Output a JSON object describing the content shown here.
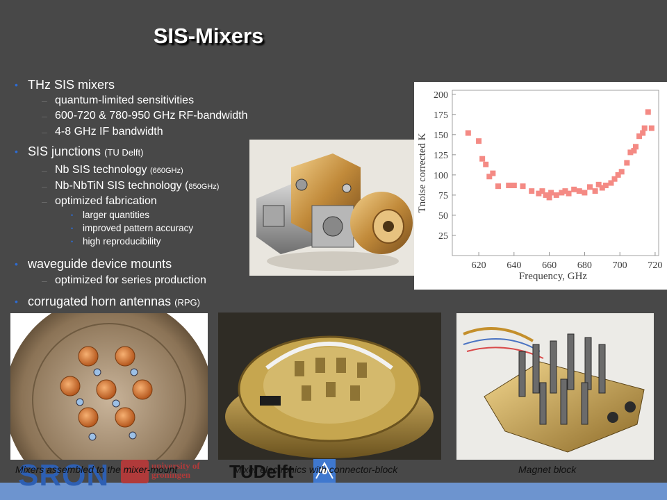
{
  "slide": {
    "title": "SIS-Mixers",
    "bullets": {
      "b1": "THz SIS mixers",
      "b1_1": "quantum-limited sensitivities",
      "b1_2": "600-720 & 780-950 GHz RF-bandwidth",
      "b1_3": "4-8 GHz IF bandwidth",
      "b2": "SIS junctions",
      "b2_note": "(TU Delft)",
      "b2_1": "Nb SIS technology",
      "b2_1_note": "(660GHz)",
      "b2_2": "Nb-NbTiN SIS technology (",
      "b2_2_note": "850GHz)",
      "b2_3": "optimized fabrication",
      "b2_3_1": "larger quantities",
      "b2_3_2": "improved pattern accuracy",
      "b2_3_3": "high reproducibility",
      "b3": "waveguide device mounts",
      "b3_1": "optimized for series production",
      "b4": "corrugated horn antennas",
      "b4_note": "(RPG)"
    },
    "captions": {
      "c1": "Mixers assembled to the mixer-mount",
      "c2": "Mixer electronics with connector-block",
      "c3": "Magnet block"
    },
    "logos": {
      "sron": "SRON",
      "tudelft": "TUDelft",
      "groningen_line1": "university of",
      "groningen_line2": "groningen"
    }
  },
  "chart_data": {
    "type": "scatter",
    "xlabel": "Frequency, GHz",
    "ylabel": "Tnoise corrected K",
    "xlim": [
      605,
      722
    ],
    "ylim": [
      0,
      205
    ],
    "xticks": [
      620,
      640,
      660,
      680,
      700,
      720
    ],
    "yticks": [
      25,
      50,
      75,
      100,
      125,
      150,
      175,
      200
    ],
    "marker_color": "#f48a84",
    "points": [
      [
        614,
        152
      ],
      [
        620,
        142
      ],
      [
        622,
        120
      ],
      [
        624,
        113
      ],
      [
        626,
        98
      ],
      [
        628,
        102
      ],
      [
        631,
        86
      ],
      [
        637,
        87
      ],
      [
        640,
        87
      ],
      [
        645,
        86
      ],
      [
        650,
        80
      ],
      [
        654,
        77
      ],
      [
        656,
        80
      ],
      [
        658,
        75
      ],
      [
        660,
        72
      ],
      [
        661,
        78
      ],
      [
        664,
        75
      ],
      [
        667,
        78
      ],
      [
        669,
        80
      ],
      [
        671,
        77
      ],
      [
        674,
        82
      ],
      [
        677,
        80
      ],
      [
        680,
        78
      ],
      [
        683,
        85
      ],
      [
        686,
        80
      ],
      [
        688,
        88
      ],
      [
        690,
        84
      ],
      [
        692,
        87
      ],
      [
        695,
        90
      ],
      [
        697,
        95
      ],
      [
        699,
        100
      ],
      [
        701,
        104
      ],
      [
        704,
        115
      ],
      [
        706,
        128
      ],
      [
        708,
        130
      ],
      [
        709,
        135
      ],
      [
        711,
        148
      ],
      [
        713,
        152
      ],
      [
        714,
        158
      ],
      [
        716,
        178
      ],
      [
        718,
        158
      ]
    ]
  }
}
